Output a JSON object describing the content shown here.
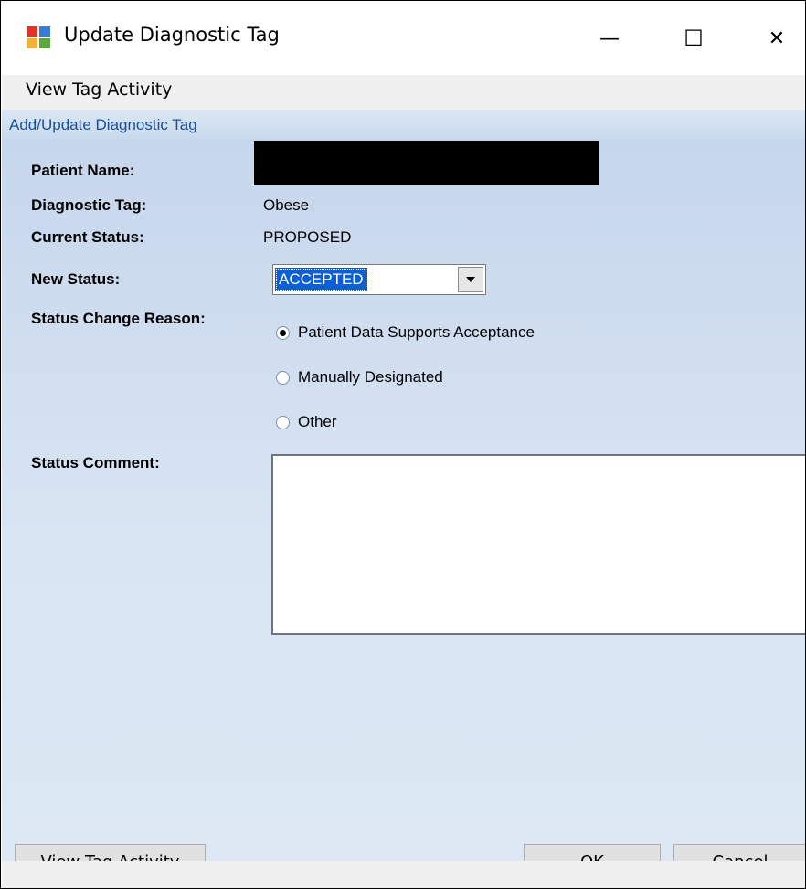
{
  "window": {
    "title": "Update Diagnostic Tag",
    "minimize_glyph": "—",
    "maximize_glyph": "☐",
    "close_glyph": "✕"
  },
  "menu": {
    "view_tag_activity": "View Tag Activity"
  },
  "section": {
    "header": "Add/Update Diagnostic Tag"
  },
  "form": {
    "patient_name_label": "Patient Name:",
    "patient_name_value": "",
    "diagnostic_tag_label": "Diagnostic Tag:",
    "diagnostic_tag_value": "Obese",
    "current_status_label": "Current Status:",
    "current_status_value": "PROPOSED",
    "new_status_label": "New Status:",
    "new_status_selected": "ACCEPTED",
    "status_change_reason_label": "Status Change Reason:",
    "reasons": [
      {
        "label": "Patient Data Supports Acceptance",
        "checked": true
      },
      {
        "label": "Manually Designated",
        "checked": false
      },
      {
        "label": "Other",
        "checked": false
      }
    ],
    "status_comment_label": "Status Comment:",
    "status_comment_value": ""
  },
  "buttons": {
    "view_tag_activity": "View Tag Activity",
    "ok": "OK",
    "cancel": "Cancel"
  },
  "colors": {
    "header_text": "#1b4f9a",
    "selection": "#0a5fd6",
    "panel_gradient_top": "#c6d6ec",
    "panel_gradient_bottom": "#dde8f4"
  }
}
